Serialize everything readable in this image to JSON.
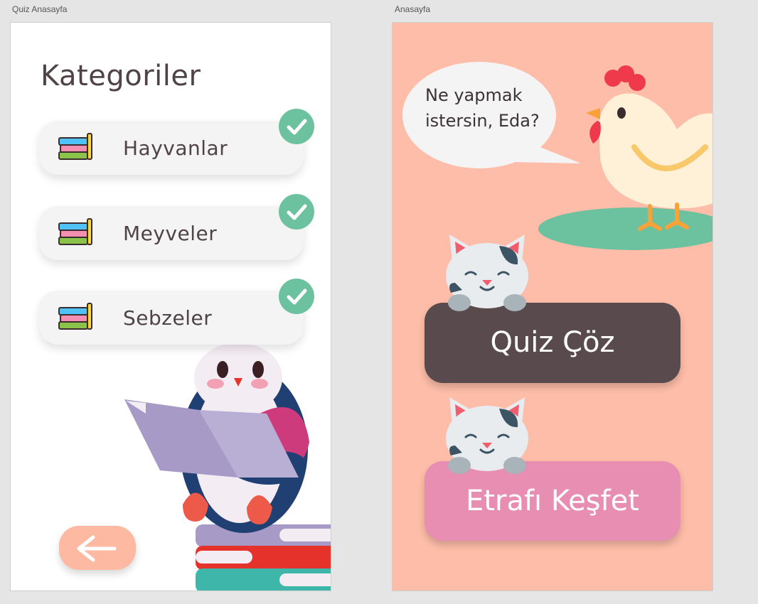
{
  "artboards": {
    "left_label": "Quiz Anasayfa",
    "right_label": "Anasayfa"
  },
  "quiz_home": {
    "title": "Kategoriler",
    "categories": [
      {
        "label": "Hayvanlar",
        "completed": true
      },
      {
        "label": "Meyveler",
        "completed": true
      },
      {
        "label": "Sebzeler",
        "completed": true
      }
    ],
    "back_icon": "arrow-left-icon"
  },
  "home": {
    "speech": "Ne yapmak istersin, Eda?",
    "quiz_button": "Quiz Çöz",
    "explore_button": "Etrafı Keşfet"
  },
  "colors": {
    "text_dark": "#4f4346",
    "check_green": "#6cc19f",
    "peach_bg": "#fdbda8",
    "quiz_btn": "#594a4d",
    "explore_btn": "#e78eb2",
    "back_btn": "#fdb9a2"
  }
}
